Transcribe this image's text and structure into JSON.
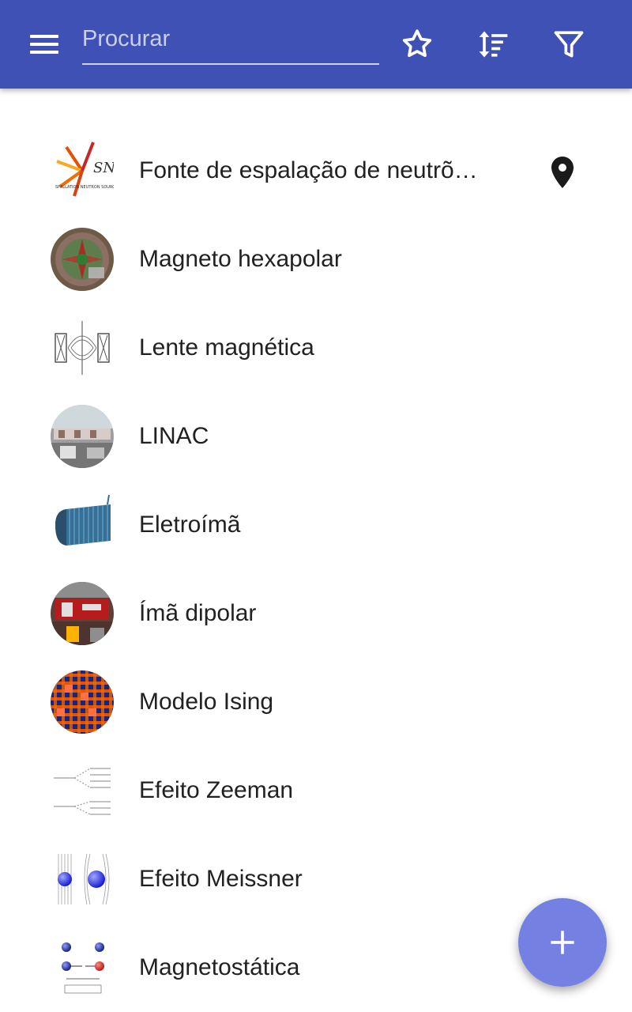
{
  "toolbar": {
    "search_placeholder": "Procurar",
    "icons": [
      "menu-icon",
      "star-icon",
      "sort-icon",
      "filter-icon"
    ],
    "color": "#3f51b5"
  },
  "items": [
    {
      "label": "Fonte de espalação de neutrõ…",
      "icon": "sns-logo",
      "has_location": true
    },
    {
      "label": "Magneto hexapolar",
      "icon": "magnet-photo"
    },
    {
      "label": "Lente magnética",
      "icon": "lens-diagram"
    },
    {
      "label": "LINAC",
      "icon": "linac-photo"
    },
    {
      "label": "Eletroímã",
      "icon": "coil-image"
    },
    {
      "label": "Ímã dipolar",
      "icon": "dipole-photo"
    },
    {
      "label": "Modelo Ising",
      "icon": "ising-lattice"
    },
    {
      "label": "Efeito Zeeman",
      "icon": "zeeman-diagram"
    },
    {
      "label": "Efeito Meissner",
      "icon": "meissner-diagram"
    },
    {
      "label": "Magnetostática",
      "icon": "magnetostatics-diagram"
    }
  ],
  "fab": {
    "icon": "plus-icon",
    "color": "#7481e2"
  }
}
